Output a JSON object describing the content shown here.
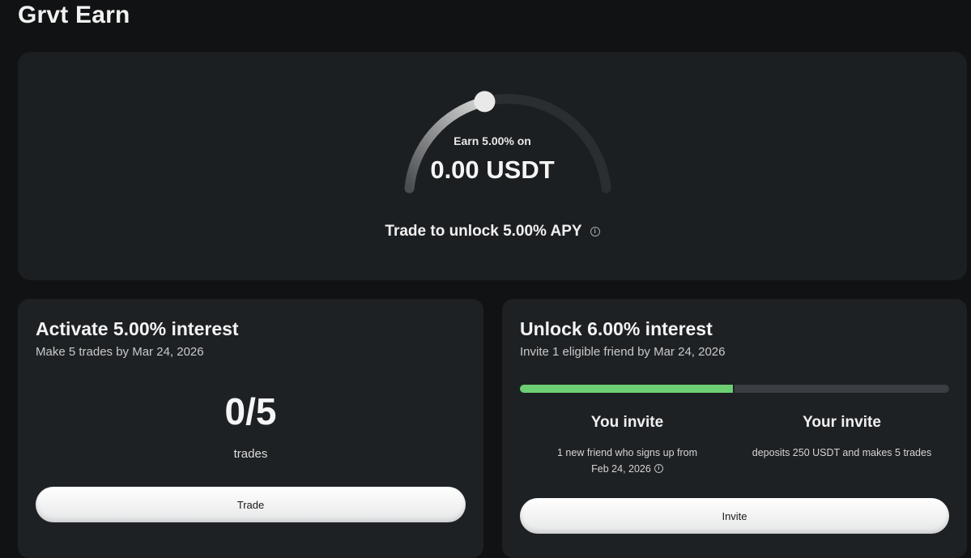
{
  "header": {
    "title": "Grvt Earn"
  },
  "hero": {
    "gauge_label": "Earn 5.00% on",
    "gauge_amount": "0.00 USDT",
    "gauge_progress": 0.42,
    "unlock_text": "Trade to unlock 5.00% APY",
    "info_icon": "info-icon"
  },
  "activate": {
    "title": "Activate 5.00% interest",
    "subtitle": "Make 5 trades by Mar 24, 2026",
    "count": "0/5",
    "count_unit": "trades",
    "button_label": "Trade"
  },
  "unlock": {
    "title": "Unlock 6.00% interest",
    "subtitle": "Invite 1 eligible friend by Mar 24, 2026",
    "progress": 0.5,
    "progress_color": "#6ccf73",
    "steps": [
      {
        "title": "You invite",
        "desc_line1": "1 new friend who signs up from",
        "desc_line2": "Feb 24, 2026"
      },
      {
        "title": "Your invite",
        "desc_line1": "deposits 250 USDT and makes 5 trades"
      }
    ],
    "button_label": "Invite"
  }
}
